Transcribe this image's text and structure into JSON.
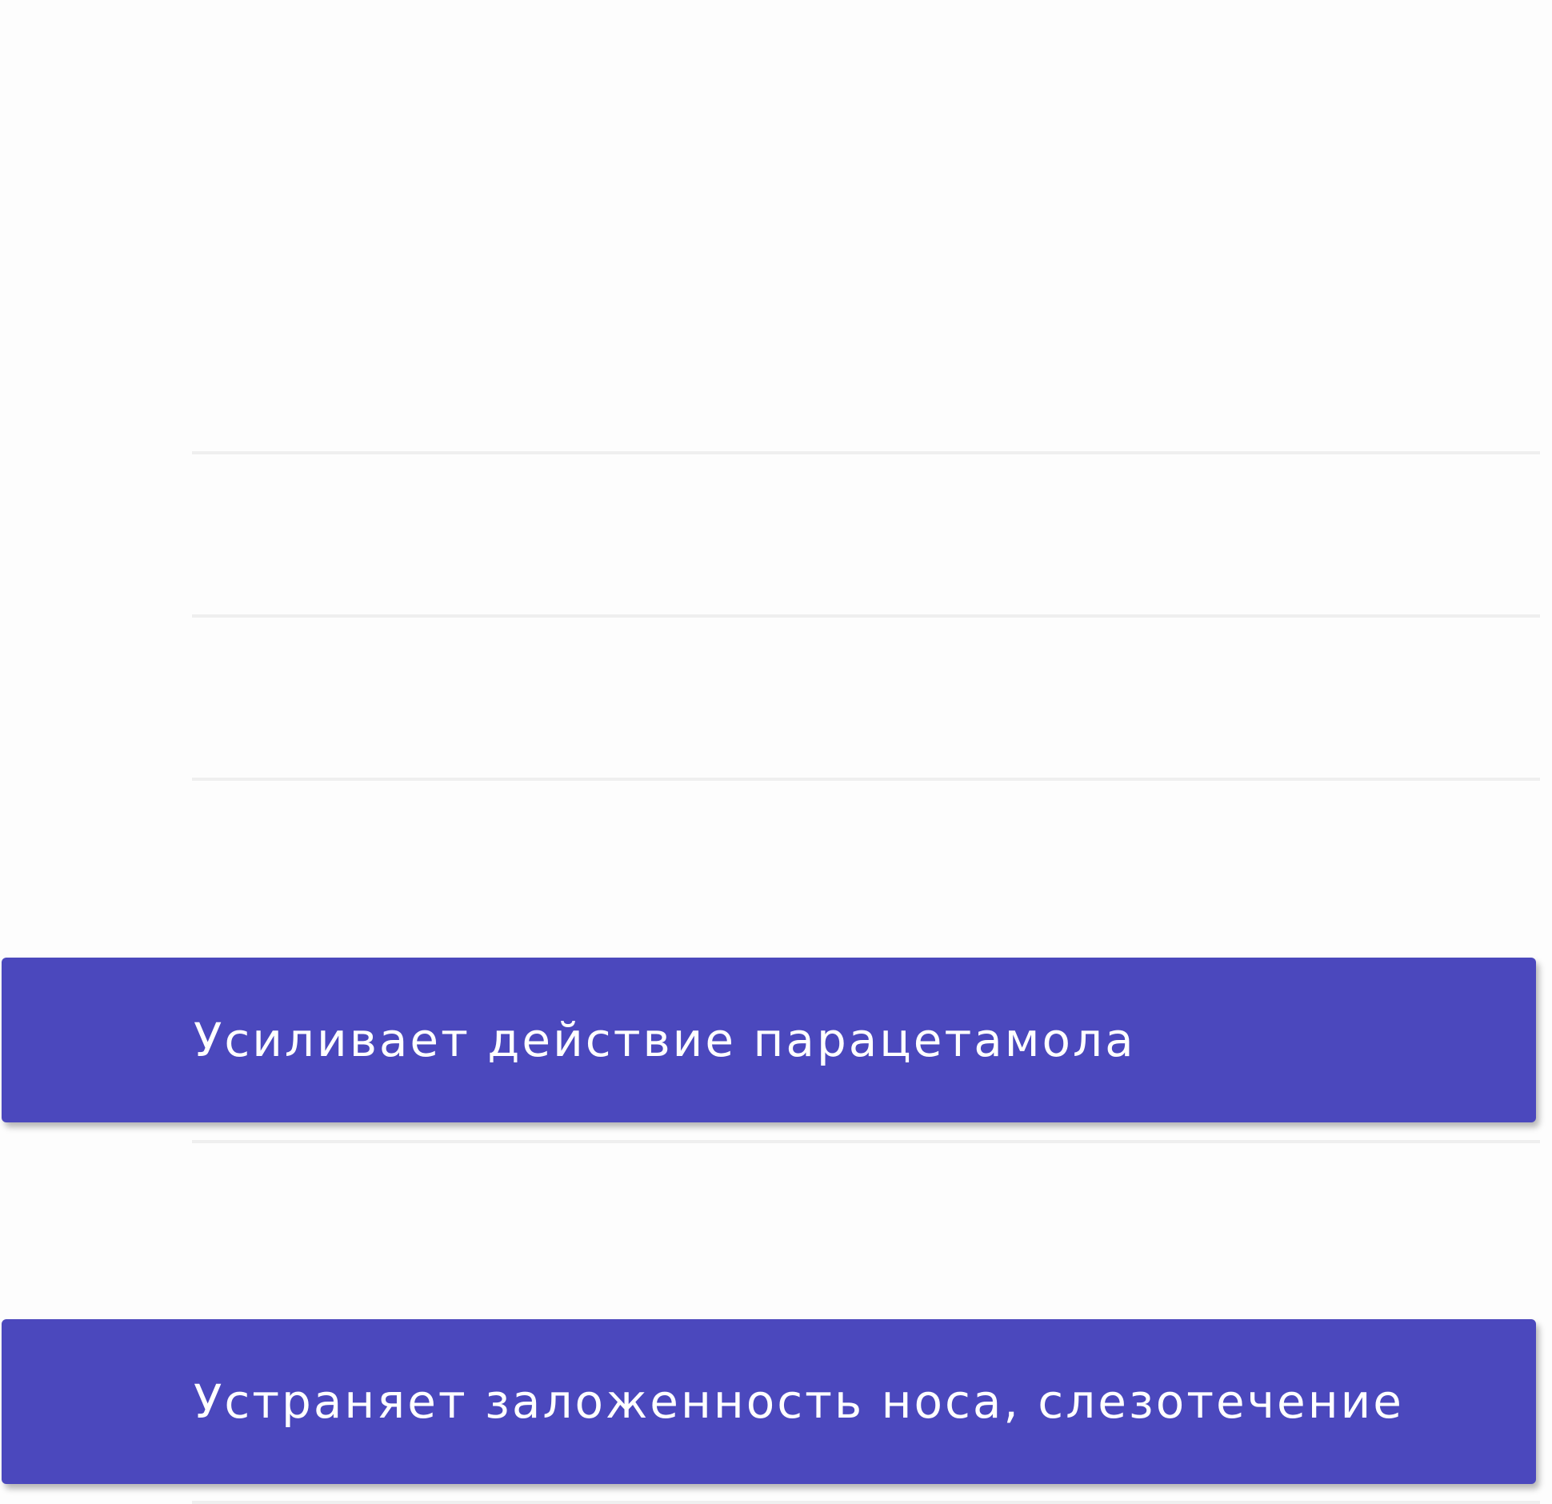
{
  "colors": {
    "background": "#fdfdfd",
    "banner": "#4b48bd",
    "banner_text": "#ffffff",
    "divider": "#efefef"
  },
  "banners": [
    {
      "text": "Усиливает действие парацетамола"
    },
    {
      "text": "Устраняет заложенность носа, слезотечение"
    }
  ]
}
